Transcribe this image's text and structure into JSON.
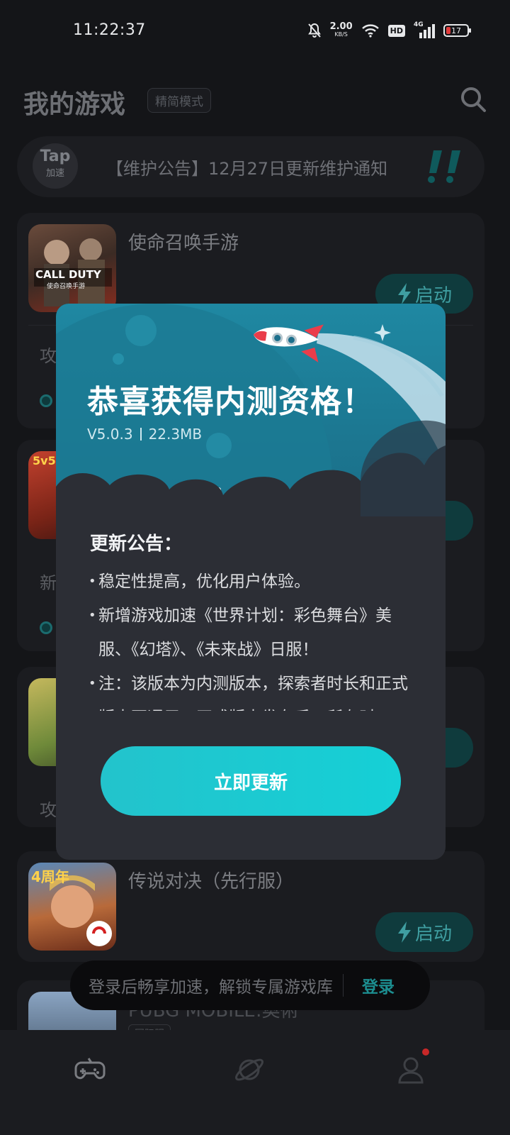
{
  "status_bar": {
    "time": "11:22:37",
    "speed_value": "2.00",
    "speed_unit": "KB/S",
    "hd": "HD",
    "network": "4G",
    "battery": "17"
  },
  "header": {
    "title": "我的游戏",
    "mode_label": "精简模式"
  },
  "notice": {
    "badge_top": "Tap",
    "badge_bottom": "加速",
    "text": "【维护公告】12月27日更新维护通知"
  },
  "games": [
    {
      "name": "使命召唤手游",
      "launch_label": "启动",
      "sub": "攻"
    },
    {
      "name": "",
      "launch_label": "动",
      "sub": "新"
    },
    {
      "name": "",
      "launch_label": "动",
      "sub": "攻"
    },
    {
      "name": "传说对决（先行服）",
      "launch_label": "启动"
    },
    {
      "name": "PUBG MOBILE:奥術",
      "tag": "国际服"
    }
  ],
  "game_icon_text": {
    "cod": "CALL DUTY",
    "cod_sub": "使命召唤手游",
    "aov": "4周年",
    "g2": "5v5"
  },
  "modal": {
    "heading": "恭喜获得内测资格！",
    "version": "V5.0.3",
    "size": "22.3MB",
    "notes_title": "更新公告：",
    "notes": [
      "稳定性提高，优化用户体验。",
      "新增游戏加速《世界计划：彩色舞台》美服、《幻塔》、《未来战》日服！",
      "注：该版本为内测版本，探索者时长和正式版本不通用，正式版本发布后，所有时"
    ],
    "update_button": "立即更新"
  },
  "toast": {
    "message": "登录后畅享加速，解锁专属游戏库",
    "login": "登录"
  },
  "colors": {
    "accent": "#15d0d6",
    "launch_bg": "#0f3b3d",
    "modal_bg": "#2c2e35",
    "hero_top": "#1e7f98"
  },
  "icons": {
    "search": "search-icon",
    "games_tab": "gamepad-icon",
    "discover_tab": "planet-icon",
    "profile_tab": "user-icon"
  }
}
